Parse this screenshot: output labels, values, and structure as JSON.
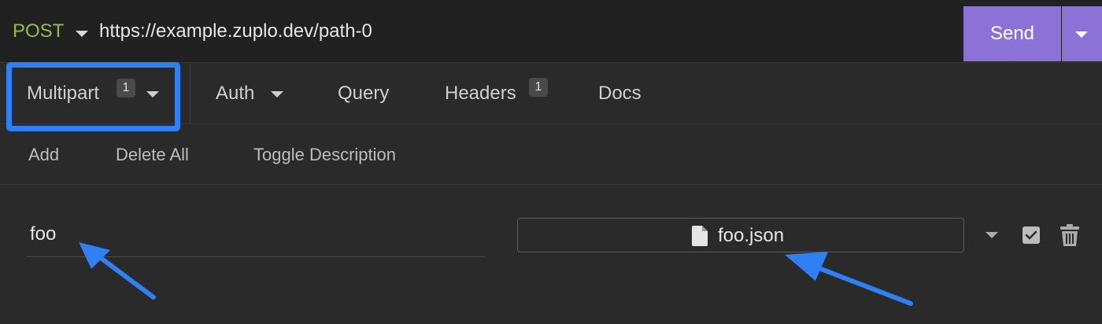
{
  "request": {
    "method": "POST",
    "url": "https://example.zuplo.dev/path-0",
    "send_label": "Send"
  },
  "tabs": [
    {
      "label": "Multipart",
      "badge": "1",
      "has_dropdown": true,
      "active": true
    },
    {
      "label": "Auth",
      "badge": "",
      "has_dropdown": true
    },
    {
      "label": "Query",
      "badge": ""
    },
    {
      "label": "Headers",
      "badge": "1"
    },
    {
      "label": "Docs",
      "badge": ""
    }
  ],
  "actions": {
    "add": "Add",
    "delete_all": "Delete All",
    "toggle_description": "Toggle Description"
  },
  "param": {
    "name": "foo",
    "file_name": "foo.json",
    "enabled": true
  },
  "colors": {
    "method": "#8fbf4a",
    "send": "#8a72d6",
    "highlight": "#2f80f5"
  }
}
